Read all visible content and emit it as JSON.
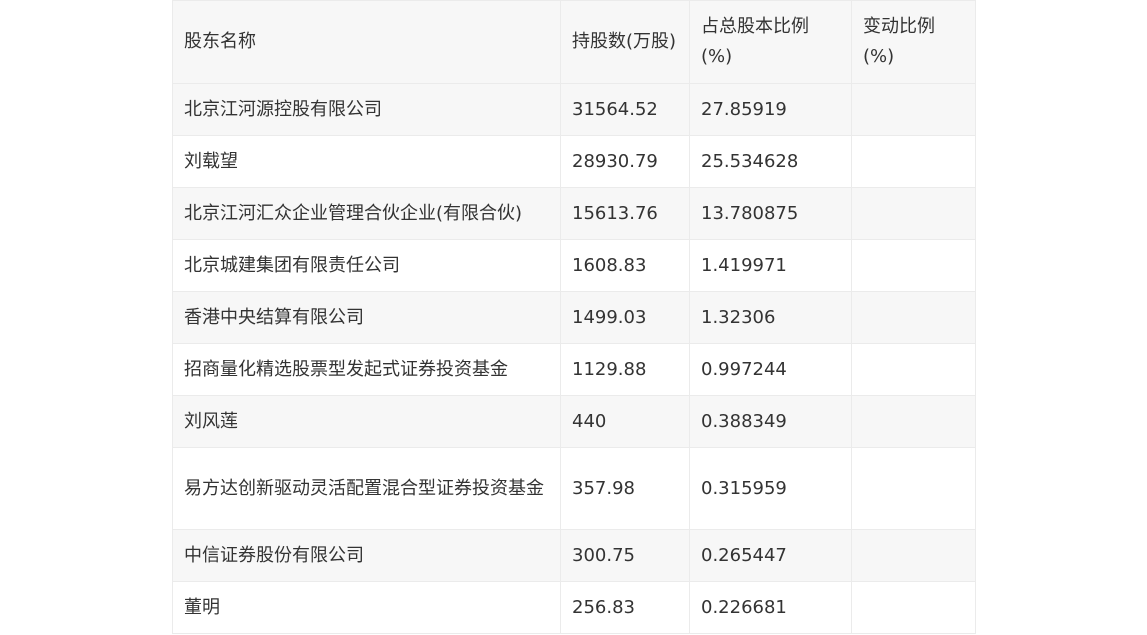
{
  "table": {
    "headers": [
      "股东名称",
      "持股数(万股)",
      "占总股本比例(%)",
      "变动比例(%)"
    ],
    "rows": [
      [
        "北京江河源控股有限公司",
        "31564.52",
        "27.85919",
        ""
      ],
      [
        "刘载望",
        "28930.79",
        "25.534628",
        ""
      ],
      [
        "北京江河汇众企业管理合伙企业(有限合伙)",
        "15613.76",
        "13.780875",
        ""
      ],
      [
        "北京城建集团有限责任公司",
        "1608.83",
        "1.419971",
        ""
      ],
      [
        "香港中央结算有限公司",
        "1499.03",
        "1.32306",
        ""
      ],
      [
        "招商量化精选股票型发起式证券投资基金",
        "1129.88",
        "0.997244",
        ""
      ],
      [
        "刘风莲",
        "440",
        "0.388349",
        ""
      ],
      [
        "易方达创新驱动灵活配置混合型证券投资基金",
        "357.98",
        "0.315959",
        ""
      ],
      [
        "中信证券股份有限公司",
        "300.75",
        "0.265447",
        ""
      ],
      [
        "董明",
        "256.83",
        "0.226681",
        ""
      ]
    ]
  }
}
